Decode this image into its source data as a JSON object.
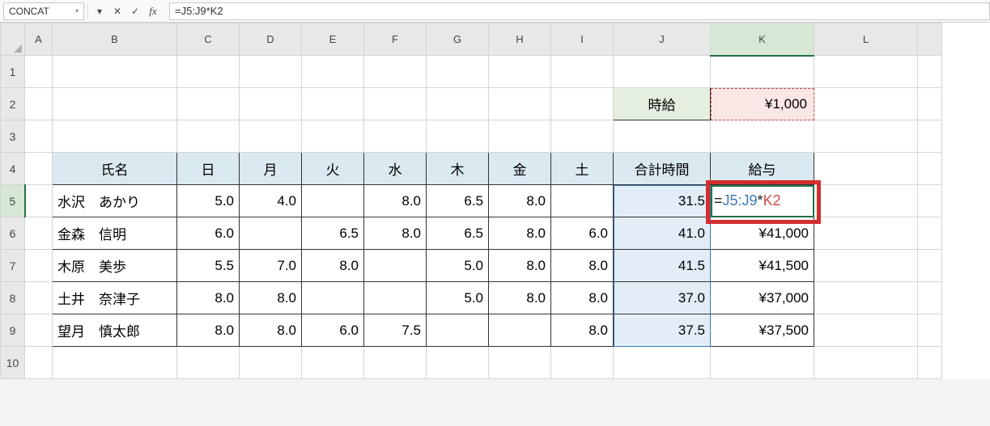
{
  "name_box": "CONCAT",
  "formula_bar": "=J5:J9*K2",
  "formula_cell_parts": {
    "eq": "=",
    "ref1": "J5:J9",
    "op": "*",
    "ref2": "K2"
  },
  "fx_label": "fx",
  "columns": [
    "A",
    "B",
    "C",
    "D",
    "E",
    "F",
    "G",
    "H",
    "I",
    "J",
    "K",
    "L",
    ""
  ],
  "rows": [
    "1",
    "2",
    "3",
    "4",
    "5",
    "6",
    "7",
    "8",
    "9",
    "10"
  ],
  "labels": {
    "wage_label": "時給",
    "wage_value": "¥1,000",
    "name_header": "氏名",
    "days": [
      "日",
      "月",
      "火",
      "水",
      "木",
      "金",
      "土"
    ],
    "total_hours": "合計時間",
    "salary": "給与"
  },
  "data_rows": [
    {
      "name": "水沢　あかり",
      "d": [
        "5.0",
        "4.0",
        "",
        "8.0",
        "6.5",
        "8.0",
        ""
      ],
      "total": "31.5",
      "salary_formula": true
    },
    {
      "name": "金森　信明",
      "d": [
        "6.0",
        "",
        "6.5",
        "8.0",
        "6.5",
        "8.0",
        "6.0"
      ],
      "total": "41.0",
      "salary": "¥41,000"
    },
    {
      "name": "木原　美歩",
      "d": [
        "5.5",
        "7.0",
        "8.0",
        "",
        "5.0",
        "8.0",
        "8.0"
      ],
      "total": "41.5",
      "salary": "¥41,500"
    },
    {
      "name": "土井　奈津子",
      "d": [
        "8.0",
        "8.0",
        "",
        "",
        "5.0",
        "8.0",
        "8.0"
      ],
      "total": "37.0",
      "salary": "¥37,000"
    },
    {
      "name": "望月　慎太郎",
      "d": [
        "8.0",
        "8.0",
        "6.0",
        "7.5",
        "",
        "",
        "8.0"
      ],
      "total": "37.5",
      "salary": "¥37,500"
    }
  ],
  "icons": {
    "dropdown": "▾",
    "cancel": "✕",
    "enter": "✓"
  }
}
